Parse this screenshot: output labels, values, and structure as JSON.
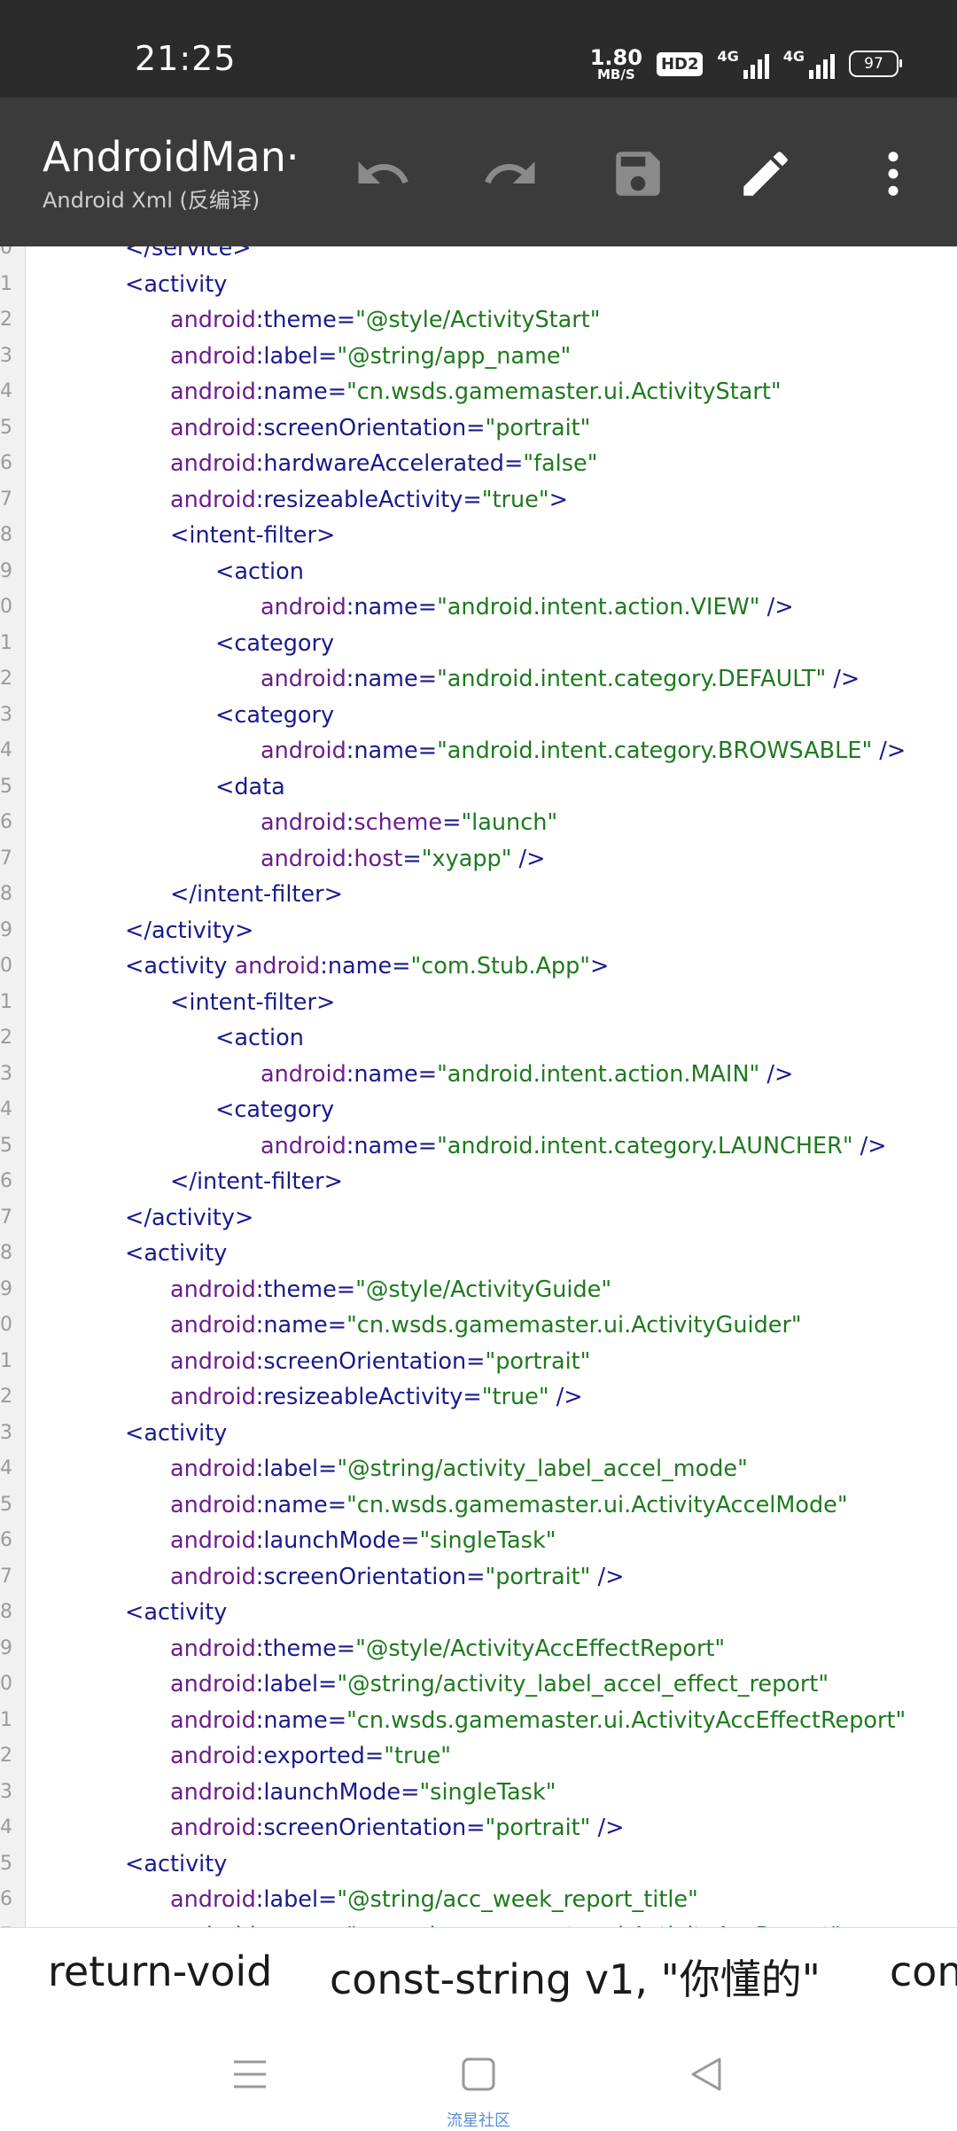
{
  "status_bar": {
    "time": "21:25",
    "net_speed_value": "1.80",
    "net_speed_unit": "MB/S",
    "hd_badge": "HD2",
    "signal1_label": "4G",
    "signal2_label": "4G",
    "battery": "97"
  },
  "app_bar": {
    "title": "AndroidMan···",
    "subtitle": "Android Xml (反编译)",
    "undo_icon": "undo-icon",
    "redo_icon": "redo-icon",
    "save_icon": "save-icon",
    "edit_icon": "edit-icon",
    "more_icon": "more-vert-icon"
  },
  "editor": {
    "lines": [
      {
        "n": "0",
        "indent": 0,
        "tokens": [
          {
            "t": "tag",
            "s": "</service>"
          }
        ]
      },
      {
        "n": "1",
        "indent": 0,
        "tokens": [
          {
            "t": "tag",
            "s": "<activity"
          }
        ]
      },
      {
        "n": "2",
        "indent": 1,
        "tokens": [
          {
            "t": "ns",
            "s": "android"
          },
          {
            "t": "eq",
            "s": ":"
          },
          {
            "t": "attr",
            "s": "theme"
          },
          {
            "t": "eq",
            "s": "="
          },
          {
            "t": "val",
            "s": "\"@style/ActivityStart\""
          }
        ]
      },
      {
        "n": "3",
        "indent": 1,
        "tokens": [
          {
            "t": "ns",
            "s": "android"
          },
          {
            "t": "eq",
            "s": ":"
          },
          {
            "t": "attr",
            "s": "label"
          },
          {
            "t": "eq",
            "s": "="
          },
          {
            "t": "val",
            "s": "\"@string/app_name\""
          }
        ]
      },
      {
        "n": "4",
        "indent": 1,
        "tokens": [
          {
            "t": "ns",
            "s": "android"
          },
          {
            "t": "eq",
            "s": ":"
          },
          {
            "t": "attr",
            "s": "name"
          },
          {
            "t": "eq",
            "s": "="
          },
          {
            "t": "val",
            "s": "\"cn.wsds.gamemaster.ui.ActivityStart\""
          }
        ]
      },
      {
        "n": "5",
        "indent": 1,
        "tokens": [
          {
            "t": "ns",
            "s": "android"
          },
          {
            "t": "eq",
            "s": ":"
          },
          {
            "t": "attr",
            "s": "screenOrientation"
          },
          {
            "t": "eq",
            "s": "="
          },
          {
            "t": "val",
            "s": "\"portrait\""
          }
        ]
      },
      {
        "n": "6",
        "indent": 1,
        "tokens": [
          {
            "t": "ns",
            "s": "android"
          },
          {
            "t": "eq",
            "s": ":"
          },
          {
            "t": "attr",
            "s": "hardwareAccelerated"
          },
          {
            "t": "eq",
            "s": "="
          },
          {
            "t": "val",
            "s": "\"false\""
          }
        ]
      },
      {
        "n": "7",
        "indent": 1,
        "tokens": [
          {
            "t": "ns",
            "s": "android"
          },
          {
            "t": "eq",
            "s": ":"
          },
          {
            "t": "attr",
            "s": "resizeableActivity"
          },
          {
            "t": "eq",
            "s": "="
          },
          {
            "t": "val",
            "s": "\"true\""
          },
          {
            "t": "tag",
            "s": ">"
          }
        ]
      },
      {
        "n": "8",
        "indent": 1,
        "tokens": [
          {
            "t": "tag",
            "s": "<intent-filter>"
          }
        ]
      },
      {
        "n": "9",
        "indent": 2,
        "tokens": [
          {
            "t": "tag",
            "s": "<action"
          }
        ]
      },
      {
        "n": "0",
        "indent": 3,
        "tokens": [
          {
            "t": "ns",
            "s": "android"
          },
          {
            "t": "eq",
            "s": ":"
          },
          {
            "t": "attr",
            "s": "name"
          },
          {
            "t": "eq",
            "s": "="
          },
          {
            "t": "val",
            "s": "\"android.intent.action.VIEW\""
          },
          {
            "t": "tag",
            "s": " />"
          }
        ]
      },
      {
        "n": "1",
        "indent": 2,
        "tokens": [
          {
            "t": "tag",
            "s": "<category"
          }
        ]
      },
      {
        "n": "2",
        "indent": 3,
        "tokens": [
          {
            "t": "ns",
            "s": "android"
          },
          {
            "t": "eq",
            "s": ":"
          },
          {
            "t": "attr",
            "s": "name"
          },
          {
            "t": "eq",
            "s": "="
          },
          {
            "t": "val",
            "s": "\"android.intent.category.DEFAULT\""
          },
          {
            "t": "tag",
            "s": " />"
          }
        ]
      },
      {
        "n": "3",
        "indent": 2,
        "tokens": [
          {
            "t": "tag",
            "s": "<category"
          }
        ]
      },
      {
        "n": "4",
        "indent": 3,
        "tokens": [
          {
            "t": "ns",
            "s": "android"
          },
          {
            "t": "eq",
            "s": ":"
          },
          {
            "t": "attr",
            "s": "name"
          },
          {
            "t": "eq",
            "s": "="
          },
          {
            "t": "val",
            "s": "\"android.intent.category.BROWSABLE\""
          },
          {
            "t": "tag",
            "s": " />"
          }
        ]
      },
      {
        "n": "5",
        "indent": 2,
        "tokens": [
          {
            "t": "tag",
            "s": "<data"
          }
        ]
      },
      {
        "n": "6",
        "indent": 3,
        "tokens": [
          {
            "t": "ns",
            "s": "android"
          },
          {
            "t": "eq",
            "s": ":"
          },
          {
            "t": "ns",
            "s": "scheme"
          },
          {
            "t": "eq",
            "s": "="
          },
          {
            "t": "val",
            "s": "\"launch\""
          }
        ]
      },
      {
        "n": "7",
        "indent": 3,
        "tokens": [
          {
            "t": "ns",
            "s": "android"
          },
          {
            "t": "eq",
            "s": ":"
          },
          {
            "t": "ns",
            "s": "host"
          },
          {
            "t": "eq",
            "s": "="
          },
          {
            "t": "val",
            "s": "\"xyapp\""
          },
          {
            "t": "tag",
            "s": " />"
          }
        ]
      },
      {
        "n": "8",
        "indent": 1,
        "tokens": [
          {
            "t": "tag",
            "s": "</intent-filter>"
          }
        ]
      },
      {
        "n": "9",
        "indent": 0,
        "tokens": [
          {
            "t": "tag",
            "s": "</activity>"
          }
        ]
      },
      {
        "n": "0",
        "indent": 0,
        "tokens": [
          {
            "t": "tag",
            "s": "<activity "
          },
          {
            "t": "ns",
            "s": "android"
          },
          {
            "t": "eq",
            "s": ":"
          },
          {
            "t": "attr",
            "s": "name"
          },
          {
            "t": "eq",
            "s": "="
          },
          {
            "t": "val",
            "s": "\"com.Stub.App\""
          },
          {
            "t": "tag",
            "s": ">"
          }
        ]
      },
      {
        "n": "1",
        "indent": 1,
        "tokens": [
          {
            "t": "tag",
            "s": "<intent-filter>"
          }
        ]
      },
      {
        "n": "2",
        "indent": 2,
        "tokens": [
          {
            "t": "tag",
            "s": "<action"
          }
        ]
      },
      {
        "n": "3",
        "indent": 3,
        "tokens": [
          {
            "t": "ns",
            "s": "android"
          },
          {
            "t": "eq",
            "s": ":"
          },
          {
            "t": "attr",
            "s": "name"
          },
          {
            "t": "eq",
            "s": "="
          },
          {
            "t": "val",
            "s": "\"android.intent.action.MAIN\""
          },
          {
            "t": "tag",
            "s": " />"
          }
        ]
      },
      {
        "n": "4",
        "indent": 2,
        "tokens": [
          {
            "t": "tag",
            "s": "<category"
          }
        ]
      },
      {
        "n": "5",
        "indent": 3,
        "tokens": [
          {
            "t": "ns",
            "s": "android"
          },
          {
            "t": "eq",
            "s": ":"
          },
          {
            "t": "attr",
            "s": "name"
          },
          {
            "t": "eq",
            "s": "="
          },
          {
            "t": "val",
            "s": "\"android.intent.category.LAUNCHER\""
          },
          {
            "t": "tag",
            "s": " />"
          }
        ]
      },
      {
        "n": "6",
        "indent": 1,
        "tokens": [
          {
            "t": "tag",
            "s": "</intent-filter>"
          }
        ]
      },
      {
        "n": "7",
        "indent": 0,
        "tokens": [
          {
            "t": "tag",
            "s": "</activity>"
          }
        ]
      },
      {
        "n": "8",
        "indent": 0,
        "tokens": [
          {
            "t": "tag",
            "s": "<activity"
          }
        ]
      },
      {
        "n": "9",
        "indent": 1,
        "tokens": [
          {
            "t": "ns",
            "s": "android"
          },
          {
            "t": "eq",
            "s": ":"
          },
          {
            "t": "attr",
            "s": "theme"
          },
          {
            "t": "eq",
            "s": "="
          },
          {
            "t": "val",
            "s": "\"@style/ActivityGuide\""
          }
        ]
      },
      {
        "n": "0",
        "indent": 1,
        "tokens": [
          {
            "t": "ns",
            "s": "android"
          },
          {
            "t": "eq",
            "s": ":"
          },
          {
            "t": "attr",
            "s": "name"
          },
          {
            "t": "eq",
            "s": "="
          },
          {
            "t": "val",
            "s": "\"cn.wsds.gamemaster.ui.ActivityGuider\""
          }
        ]
      },
      {
        "n": "1",
        "indent": 1,
        "tokens": [
          {
            "t": "ns",
            "s": "android"
          },
          {
            "t": "eq",
            "s": ":"
          },
          {
            "t": "attr",
            "s": "screenOrientation"
          },
          {
            "t": "eq",
            "s": "="
          },
          {
            "t": "val",
            "s": "\"portrait\""
          }
        ]
      },
      {
        "n": "2",
        "indent": 1,
        "tokens": [
          {
            "t": "ns",
            "s": "android"
          },
          {
            "t": "eq",
            "s": ":"
          },
          {
            "t": "attr",
            "s": "resizeableActivity"
          },
          {
            "t": "eq",
            "s": "="
          },
          {
            "t": "val",
            "s": "\"true\""
          },
          {
            "t": "tag",
            "s": " />"
          }
        ]
      },
      {
        "n": "3",
        "indent": 0,
        "tokens": [
          {
            "t": "tag",
            "s": "<activity"
          }
        ]
      },
      {
        "n": "4",
        "indent": 1,
        "tokens": [
          {
            "t": "ns",
            "s": "android"
          },
          {
            "t": "eq",
            "s": ":"
          },
          {
            "t": "attr",
            "s": "label"
          },
          {
            "t": "eq",
            "s": "="
          },
          {
            "t": "val",
            "s": "\"@string/activity_label_accel_mode\""
          }
        ]
      },
      {
        "n": "5",
        "indent": 1,
        "tokens": [
          {
            "t": "ns",
            "s": "android"
          },
          {
            "t": "eq",
            "s": ":"
          },
          {
            "t": "attr",
            "s": "name"
          },
          {
            "t": "eq",
            "s": "="
          },
          {
            "t": "val",
            "s": "\"cn.wsds.gamemaster.ui.ActivityAccelMode\""
          }
        ]
      },
      {
        "n": "6",
        "indent": 1,
        "tokens": [
          {
            "t": "ns",
            "s": "android"
          },
          {
            "t": "eq",
            "s": ":"
          },
          {
            "t": "attr",
            "s": "launchMode"
          },
          {
            "t": "eq",
            "s": "="
          },
          {
            "t": "val",
            "s": "\"singleTask\""
          }
        ]
      },
      {
        "n": "7",
        "indent": 1,
        "tokens": [
          {
            "t": "ns",
            "s": "android"
          },
          {
            "t": "eq",
            "s": ":"
          },
          {
            "t": "attr",
            "s": "screenOrientation"
          },
          {
            "t": "eq",
            "s": "="
          },
          {
            "t": "val",
            "s": "\"portrait\""
          },
          {
            "t": "tag",
            "s": " />"
          }
        ]
      },
      {
        "n": "8",
        "indent": 0,
        "tokens": [
          {
            "t": "tag",
            "s": "<activity"
          }
        ]
      },
      {
        "n": "9",
        "indent": 1,
        "tokens": [
          {
            "t": "ns",
            "s": "android"
          },
          {
            "t": "eq",
            "s": ":"
          },
          {
            "t": "attr",
            "s": "theme"
          },
          {
            "t": "eq",
            "s": "="
          },
          {
            "t": "val",
            "s": "\"@style/ActivityAccEffectReport\""
          }
        ]
      },
      {
        "n": "0",
        "indent": 1,
        "tokens": [
          {
            "t": "ns",
            "s": "android"
          },
          {
            "t": "eq",
            "s": ":"
          },
          {
            "t": "attr",
            "s": "label"
          },
          {
            "t": "eq",
            "s": "="
          },
          {
            "t": "val",
            "s": "\"@string/activity_label_accel_effect_report\""
          }
        ]
      },
      {
        "n": "1",
        "indent": 1,
        "tokens": [
          {
            "t": "ns",
            "s": "android"
          },
          {
            "t": "eq",
            "s": ":"
          },
          {
            "t": "attr",
            "s": "name"
          },
          {
            "t": "eq",
            "s": "="
          },
          {
            "t": "val",
            "s": "\"cn.wsds.gamemaster.ui.ActivityAccEffectReport\""
          }
        ]
      },
      {
        "n": "2",
        "indent": 1,
        "tokens": [
          {
            "t": "ns",
            "s": "android"
          },
          {
            "t": "eq",
            "s": ":"
          },
          {
            "t": "attr",
            "s": "exported"
          },
          {
            "t": "eq",
            "s": "="
          },
          {
            "t": "val",
            "s": "\"true\""
          }
        ]
      },
      {
        "n": "3",
        "indent": 1,
        "tokens": [
          {
            "t": "ns",
            "s": "android"
          },
          {
            "t": "eq",
            "s": ":"
          },
          {
            "t": "attr",
            "s": "launchMode"
          },
          {
            "t": "eq",
            "s": "="
          },
          {
            "t": "val",
            "s": "\"singleTask\""
          }
        ]
      },
      {
        "n": "4",
        "indent": 1,
        "tokens": [
          {
            "t": "ns",
            "s": "android"
          },
          {
            "t": "eq",
            "s": ":"
          },
          {
            "t": "attr",
            "s": "screenOrientation"
          },
          {
            "t": "eq",
            "s": "="
          },
          {
            "t": "val",
            "s": "\"portrait\""
          },
          {
            "t": "tag",
            "s": " />"
          }
        ]
      },
      {
        "n": "5",
        "indent": 0,
        "tokens": [
          {
            "t": "tag",
            "s": "<activity"
          }
        ]
      },
      {
        "n": "6",
        "indent": 1,
        "tokens": [
          {
            "t": "ns",
            "s": "android"
          },
          {
            "t": "eq",
            "s": ":"
          },
          {
            "t": "attr",
            "s": "label"
          },
          {
            "t": "eq",
            "s": "="
          },
          {
            "t": "val",
            "s": "\"@string/acc_week_report_title\""
          }
        ]
      },
      {
        "n": "7",
        "indent": 1,
        "tokens": [
          {
            "t": "ns",
            "s": "android"
          },
          {
            "t": "eq",
            "s": ":"
          },
          {
            "t": "attr",
            "s": "name"
          },
          {
            "t": "eq",
            "s": "="
          },
          {
            "t": "val",
            "s": "\"cn.wsds.gamemaster.ui.ActivityAccReport\""
          }
        ]
      }
    ]
  },
  "snippet_bar": {
    "items": [
      "return-void",
      "const-string v1, \"你懂的\"",
      "con"
    ]
  },
  "nav_bar": {
    "menu_icon": "menu-icon",
    "home_icon": "home-square-icon",
    "back_icon": "back-triangle-icon",
    "watermark": "流星社区"
  }
}
